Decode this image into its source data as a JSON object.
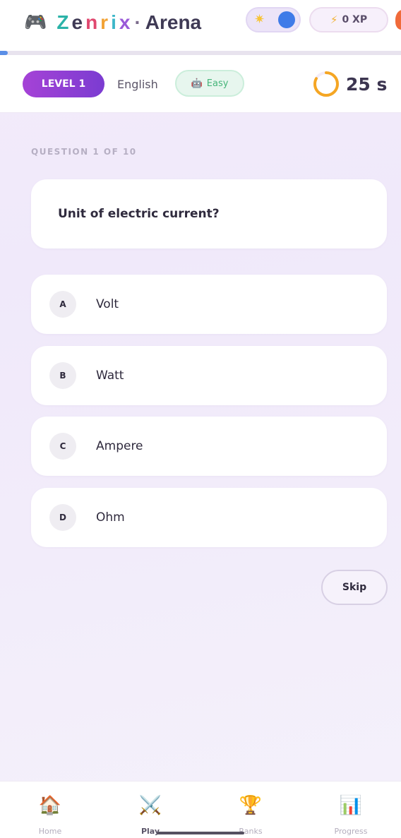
{
  "header": {
    "icon": "gamepad-icon",
    "brand_letters": [
      "Z",
      "e",
      "n",
      "r",
      "i",
      "x"
    ],
    "brand_letter_colors": [
      "#2bb3a8",
      "#3f3a55",
      "#e0486f",
      "#f2a234",
      "#3db7c9",
      "#9a5ad8"
    ],
    "brand_separator": "·",
    "brand_suffix": "Arena",
    "theme_icon": "sun-icon",
    "xp_icon": "bolt-icon",
    "xp_label": "0 XP",
    "progress_fraction": 0.02
  },
  "quiz_bar": {
    "level_label": "LEVEL 1",
    "language": "English",
    "difficulty_icon": "robot-icon",
    "difficulty": "Easy",
    "timer_text": "25 s",
    "timer_fraction": 0.83
  },
  "question": {
    "counter": "QUESTION 1 OF 10",
    "text": "Unit of electric current?",
    "options": [
      {
        "letter": "A",
        "text": "Volt"
      },
      {
        "letter": "B",
        "text": "Watt"
      },
      {
        "letter": "C",
        "text": "Ampere"
      },
      {
        "letter": "D",
        "text": "Ohm"
      }
    ],
    "skip_label": "Skip"
  },
  "nav": {
    "items": [
      {
        "icon": "home-icon",
        "label": "Home"
      },
      {
        "icon": "swords-icon",
        "label": "Play"
      },
      {
        "icon": "trophy-icon",
        "label": "Ranks"
      },
      {
        "icon": "chart-icon",
        "label": "Progress"
      }
    ],
    "active": "Play"
  },
  "colors": {
    "accent": "#8b3fd4",
    "difficulty_green": "#46b57a",
    "timer_orange": "#f5a623",
    "toggle_blue": "#3f7be8"
  }
}
